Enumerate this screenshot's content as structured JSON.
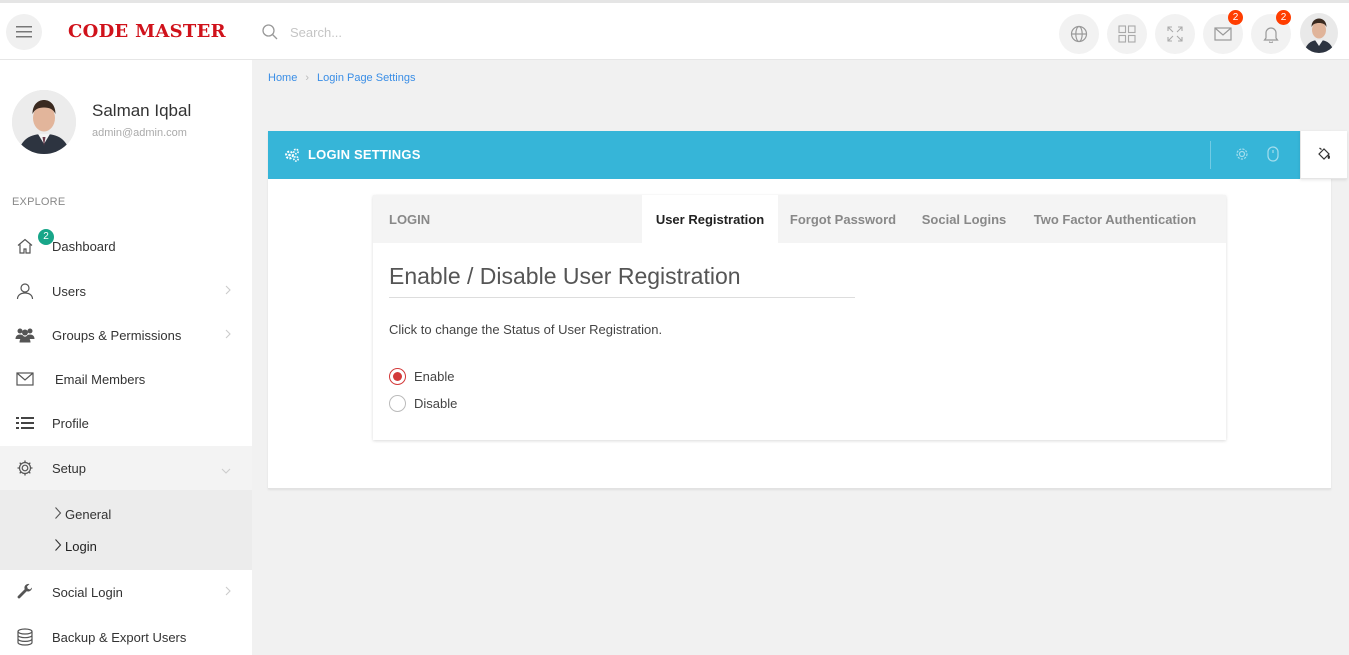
{
  "app": {
    "brand": "CODE MASTER",
    "search_placeholder": "Search..."
  },
  "header": {
    "mail_badge": "2",
    "notification_badge": "2"
  },
  "user": {
    "name": "Salman Iqbal",
    "email": "admin@admin.com"
  },
  "sidebar": {
    "section_label": "EXPLORE",
    "dashboard_badge": "2",
    "items": [
      {
        "label": "Dashboard"
      },
      {
        "label": "Users"
      },
      {
        "label": "Groups & Permissions"
      },
      {
        "label": "Email Members"
      },
      {
        "label": "Profile"
      },
      {
        "label": "Setup"
      },
      {
        "label": "Social Login"
      },
      {
        "label": "Backup & Export Users"
      }
    ],
    "setup_submenu": [
      {
        "label": "General"
      },
      {
        "label": "Login"
      }
    ]
  },
  "breadcrumb": {
    "home": "Home",
    "current": "Login Page Settings"
  },
  "panel": {
    "title": "LOGIN SETTINGS"
  },
  "tabs": [
    {
      "label": "LOGIN",
      "active": false
    },
    {
      "label": "User Registration",
      "active": true
    },
    {
      "label": "Forgot Password",
      "active": false
    },
    {
      "label": "Social Logins",
      "active": false
    },
    {
      "label": "Two Factor Authentication",
      "active": false
    }
  ],
  "registration": {
    "heading": "Enable / Disable User Registration",
    "description": "Click to change the Status of User Registration.",
    "options": [
      {
        "label": "Enable",
        "selected": true
      },
      {
        "label": "Disable",
        "selected": false
      }
    ]
  },
  "colors": {
    "brand": "#d0121b",
    "panel_header": "#36b5d8",
    "badge": "#ff3d00",
    "nav_badge": "#18a689",
    "radio_selected": "#d33a3a",
    "link": "#3a8ee6"
  }
}
